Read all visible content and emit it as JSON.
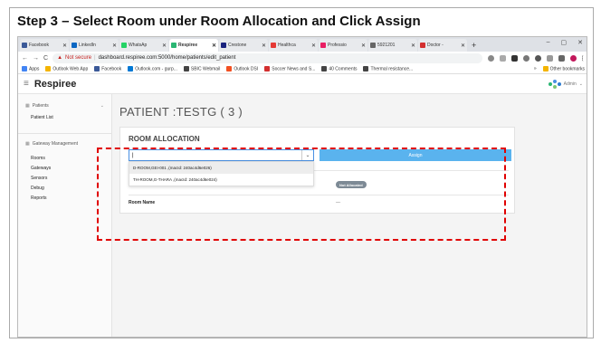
{
  "slide": {
    "title": "Step 3 – Select Room under Room Allocation and Click Assign"
  },
  "browser": {
    "tabs": [
      {
        "label": "Facebook",
        "color": "#3b5998",
        "active": false
      },
      {
        "label": "LinkedIn",
        "color": "#0a66c2",
        "active": false
      },
      {
        "label": "WhatsAp",
        "color": "#25d366",
        "active": false
      },
      {
        "label": "Respiree",
        "color": "#2bb673",
        "active": true
      },
      {
        "label": "Crestone",
        "color": "#1a237e",
        "active": false
      },
      {
        "label": "Healthca",
        "color": "#e53935",
        "active": false
      },
      {
        "label": "Professio",
        "color": "#e91e63",
        "active": false
      },
      {
        "label": "5921201",
        "color": "#666666",
        "active": false
      },
      {
        "label": "Doctor -",
        "color": "#d32f2f",
        "active": false
      }
    ],
    "new_tab": "+",
    "window_controls": {
      "minimize": "–",
      "maximize": "▢",
      "close": "✕"
    },
    "nav": {
      "back": "←",
      "forward": "→",
      "reload": "C"
    },
    "security": {
      "warning_icon": "▲",
      "label": "Not secure"
    },
    "url": "dashboard.respiree.com:5000/home/patients/edit_patient",
    "bookmarks": [
      {
        "label": "Apps",
        "color": "#4285f4"
      },
      {
        "label": "Outlook Web App",
        "color": "#f4b400"
      },
      {
        "label": "Facebook",
        "color": "#3b5998"
      },
      {
        "label": "Outlook.com - gurp...",
        "color": "#0078d4"
      },
      {
        "label": "SBIC Webmail",
        "color": "#444444"
      },
      {
        "label": "Outlook DSI",
        "color": "#f25022"
      },
      {
        "label": "Soccer News and S...",
        "color": "#d32f2f"
      },
      {
        "label": "40 Comments",
        "color": "#444444"
      },
      {
        "label": "Thermal resistance...",
        "color": "#444444"
      }
    ],
    "bookmarks_more": "»",
    "other_bookmarks": "Other bookmarks"
  },
  "app": {
    "brand": "Respiree",
    "user": "Admin",
    "sidebar": {
      "patients_section": "Patients",
      "patients_items": [
        "Patient List"
      ],
      "gateway_section": "Gateway Management",
      "gateway_items": [
        "Rooms",
        "Gateways",
        "Sensors",
        "Debug",
        "Reports"
      ]
    },
    "patient_title": "PATIENT :TESTG ( 3 )",
    "room_allocation": {
      "heading": "ROOM ALLOCATION",
      "select_value": "|",
      "options": [
        "D-ROOM,GEI-001 ,(macId: 240ac4d6e026)",
        "TH-ROOM,G-THARA ,(macId: 240ac4d6e024)"
      ],
      "assign_label": "Assign",
      "status_badge": "Not Allocated",
      "room_name_label": "Room Name",
      "room_name_value": "---"
    }
  },
  "colors": {
    "accent": "#5ab3ee",
    "callout": "#e00000",
    "badge": "#7d8a95"
  }
}
